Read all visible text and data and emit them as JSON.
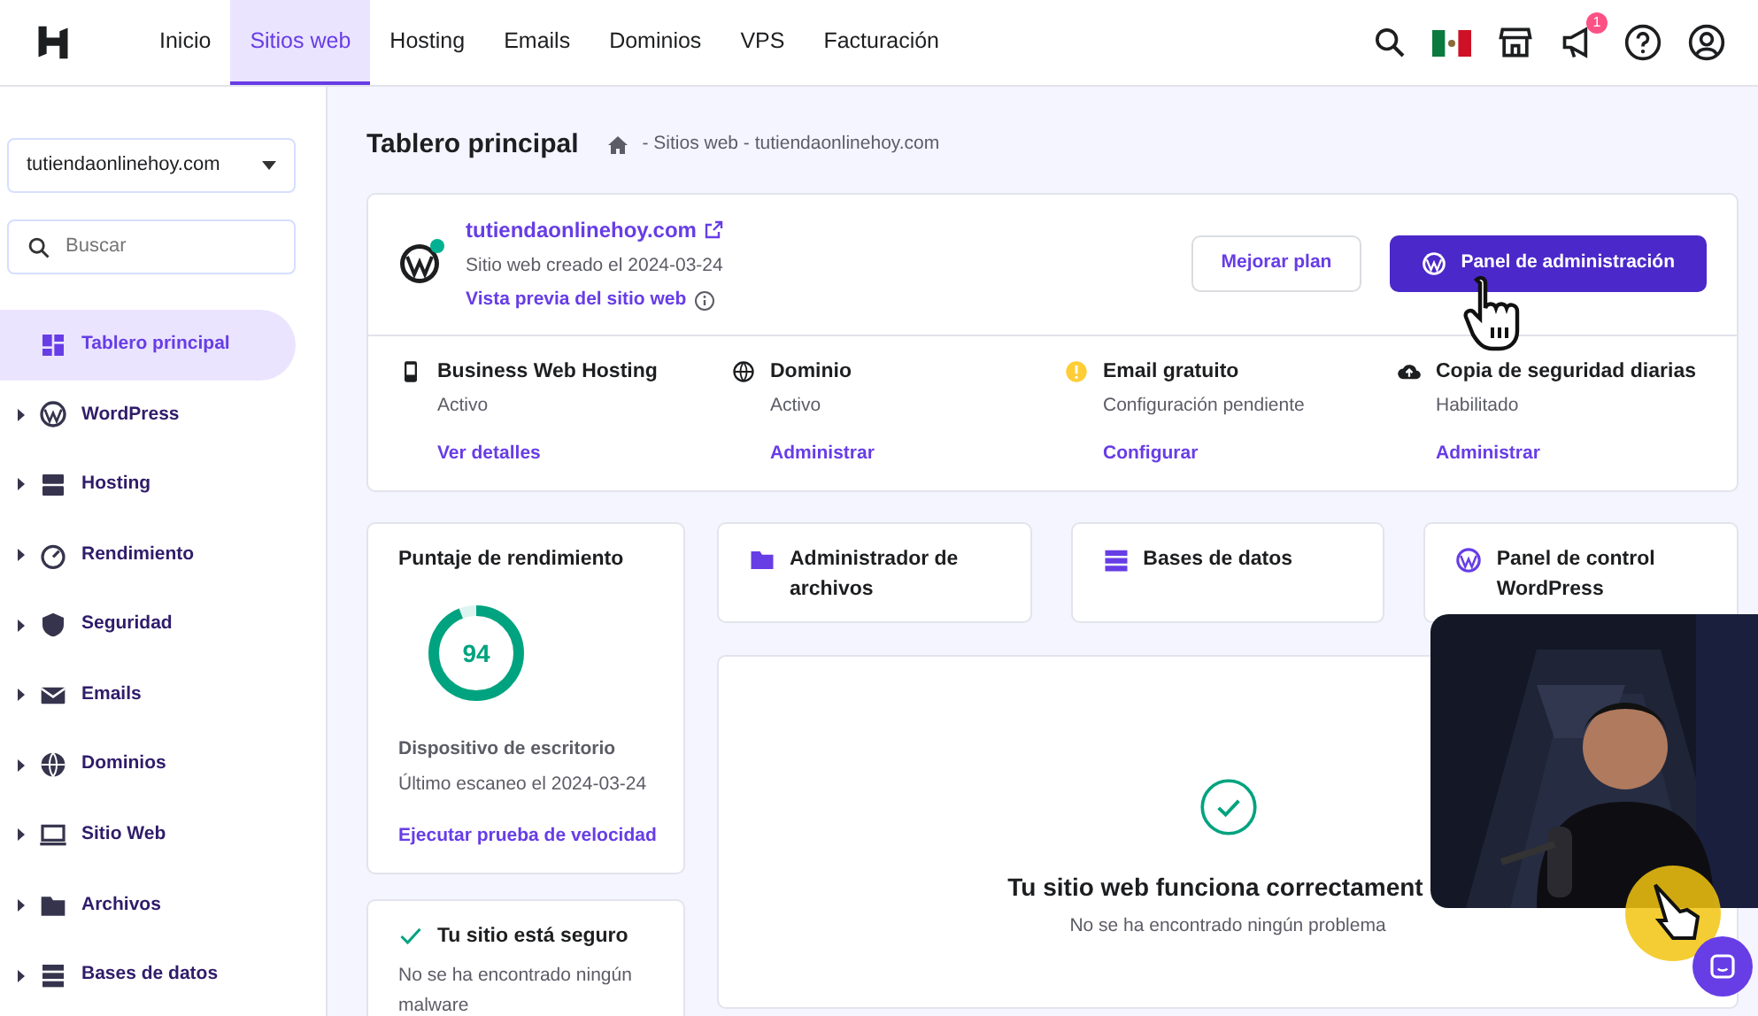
{
  "nav": {
    "items": [
      {
        "label": "Inicio",
        "selected": false
      },
      {
        "label": "Sitios web",
        "selected": true
      },
      {
        "label": "Hosting",
        "selected": false
      },
      {
        "label": "Emails",
        "selected": false
      },
      {
        "label": "Dominios",
        "selected": false
      },
      {
        "label": "VPS",
        "selected": false
      },
      {
        "label": "Facturación",
        "selected": false
      }
    ],
    "notification_count": "1"
  },
  "sidebar": {
    "domain_select": "tutiendaonlinehoy.com",
    "search_placeholder": "Buscar",
    "items": [
      {
        "label": "Tablero principal",
        "selected": true,
        "expandable": false
      },
      {
        "label": "WordPress",
        "selected": false,
        "expandable": true
      },
      {
        "label": "Hosting",
        "selected": false,
        "expandable": true
      },
      {
        "label": "Rendimiento",
        "selected": false,
        "expandable": true
      },
      {
        "label": "Seguridad",
        "selected": false,
        "expandable": true
      },
      {
        "label": "Emails",
        "selected": false,
        "expandable": true
      },
      {
        "label": "Dominios",
        "selected": false,
        "expandable": true
      },
      {
        "label": "Sitio Web",
        "selected": false,
        "expandable": true
      },
      {
        "label": "Archivos",
        "selected": false,
        "expandable": true
      },
      {
        "label": "Bases de datos",
        "selected": false,
        "expandable": true
      }
    ]
  },
  "header": {
    "title": "Tablero principal",
    "breadcrumb": "- Sitios web - tutiendaonlinehoy.com"
  },
  "site": {
    "domain": "tutiendaonlinehoy.com",
    "created": "Sitio web creado el 2024-03-24",
    "preview_link": "Vista previa del sitio web",
    "upgrade_button": "Mejorar plan",
    "admin_button": "Panel de administración",
    "services": [
      {
        "kind": "hosting",
        "title": "Business Web Hosting",
        "status": "Activo",
        "link": "Ver detalles"
      },
      {
        "kind": "domain",
        "title": "Dominio",
        "status": "Activo",
        "link": "Administrar"
      },
      {
        "kind": "email",
        "title": "Email gratuito",
        "status": "Configuración pendiente",
        "link": "Configurar"
      },
      {
        "kind": "backup",
        "title": "Copia de seguridad diarias",
        "status": "Habilitado",
        "link": "Administrar"
      }
    ]
  },
  "performance": {
    "title": "Puntaje de rendimiento",
    "score": "94",
    "level": 0.94,
    "device": "Dispositivo de escritorio",
    "scan": "Último escaneo el 2024-03-24",
    "link": "Ejecutar prueba de velocidad"
  },
  "tools": [
    {
      "kind": "folder",
      "label": "Administrador de archivos"
    },
    {
      "kind": "database",
      "label": "Bases de datos"
    },
    {
      "kind": "wordpress",
      "label": "Panel de control WordPress"
    }
  ],
  "security": {
    "title": "Tu sitio está seguro",
    "text": "No se ha encontrado ningún malware"
  },
  "status": {
    "title": "Tu sitio web funciona correctament",
    "text": "No se ha encontrado ningún problema"
  }
}
